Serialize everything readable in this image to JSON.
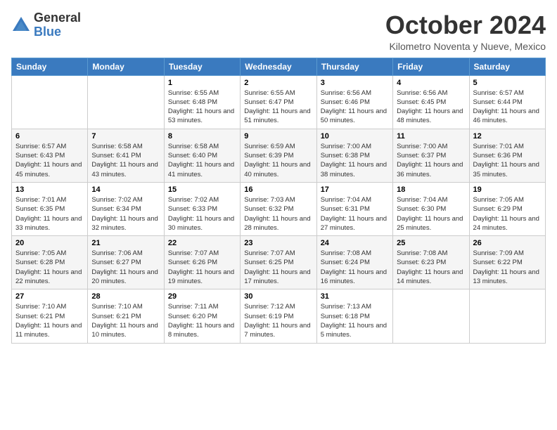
{
  "header": {
    "logo_general": "General",
    "logo_blue": "Blue",
    "month_title": "October 2024",
    "location": "Kilometro Noventa y Nueve, Mexico"
  },
  "days_of_week": [
    "Sunday",
    "Monday",
    "Tuesday",
    "Wednesday",
    "Thursday",
    "Friday",
    "Saturday"
  ],
  "weeks": [
    [
      {
        "day": "",
        "sunrise": "",
        "sunset": "",
        "daylight": ""
      },
      {
        "day": "",
        "sunrise": "",
        "sunset": "",
        "daylight": ""
      },
      {
        "day": "1",
        "sunrise": "Sunrise: 6:55 AM",
        "sunset": "Sunset: 6:48 PM",
        "daylight": "Daylight: 11 hours and 53 minutes."
      },
      {
        "day": "2",
        "sunrise": "Sunrise: 6:55 AM",
        "sunset": "Sunset: 6:47 PM",
        "daylight": "Daylight: 11 hours and 51 minutes."
      },
      {
        "day": "3",
        "sunrise": "Sunrise: 6:56 AM",
        "sunset": "Sunset: 6:46 PM",
        "daylight": "Daylight: 11 hours and 50 minutes."
      },
      {
        "day": "4",
        "sunrise": "Sunrise: 6:56 AM",
        "sunset": "Sunset: 6:45 PM",
        "daylight": "Daylight: 11 hours and 48 minutes."
      },
      {
        "day": "5",
        "sunrise": "Sunrise: 6:57 AM",
        "sunset": "Sunset: 6:44 PM",
        "daylight": "Daylight: 11 hours and 46 minutes."
      }
    ],
    [
      {
        "day": "6",
        "sunrise": "Sunrise: 6:57 AM",
        "sunset": "Sunset: 6:43 PM",
        "daylight": "Daylight: 11 hours and 45 minutes."
      },
      {
        "day": "7",
        "sunrise": "Sunrise: 6:58 AM",
        "sunset": "Sunset: 6:41 PM",
        "daylight": "Daylight: 11 hours and 43 minutes."
      },
      {
        "day": "8",
        "sunrise": "Sunrise: 6:58 AM",
        "sunset": "Sunset: 6:40 PM",
        "daylight": "Daylight: 11 hours and 41 minutes."
      },
      {
        "day": "9",
        "sunrise": "Sunrise: 6:59 AM",
        "sunset": "Sunset: 6:39 PM",
        "daylight": "Daylight: 11 hours and 40 minutes."
      },
      {
        "day": "10",
        "sunrise": "Sunrise: 7:00 AM",
        "sunset": "Sunset: 6:38 PM",
        "daylight": "Daylight: 11 hours and 38 minutes."
      },
      {
        "day": "11",
        "sunrise": "Sunrise: 7:00 AM",
        "sunset": "Sunset: 6:37 PM",
        "daylight": "Daylight: 11 hours and 36 minutes."
      },
      {
        "day": "12",
        "sunrise": "Sunrise: 7:01 AM",
        "sunset": "Sunset: 6:36 PM",
        "daylight": "Daylight: 11 hours and 35 minutes."
      }
    ],
    [
      {
        "day": "13",
        "sunrise": "Sunrise: 7:01 AM",
        "sunset": "Sunset: 6:35 PM",
        "daylight": "Daylight: 11 hours and 33 minutes."
      },
      {
        "day": "14",
        "sunrise": "Sunrise: 7:02 AM",
        "sunset": "Sunset: 6:34 PM",
        "daylight": "Daylight: 11 hours and 32 minutes."
      },
      {
        "day": "15",
        "sunrise": "Sunrise: 7:02 AM",
        "sunset": "Sunset: 6:33 PM",
        "daylight": "Daylight: 11 hours and 30 minutes."
      },
      {
        "day": "16",
        "sunrise": "Sunrise: 7:03 AM",
        "sunset": "Sunset: 6:32 PM",
        "daylight": "Daylight: 11 hours and 28 minutes."
      },
      {
        "day": "17",
        "sunrise": "Sunrise: 7:04 AM",
        "sunset": "Sunset: 6:31 PM",
        "daylight": "Daylight: 11 hours and 27 minutes."
      },
      {
        "day": "18",
        "sunrise": "Sunrise: 7:04 AM",
        "sunset": "Sunset: 6:30 PM",
        "daylight": "Daylight: 11 hours and 25 minutes."
      },
      {
        "day": "19",
        "sunrise": "Sunrise: 7:05 AM",
        "sunset": "Sunset: 6:29 PM",
        "daylight": "Daylight: 11 hours and 24 minutes."
      }
    ],
    [
      {
        "day": "20",
        "sunrise": "Sunrise: 7:05 AM",
        "sunset": "Sunset: 6:28 PM",
        "daylight": "Daylight: 11 hours and 22 minutes."
      },
      {
        "day": "21",
        "sunrise": "Sunrise: 7:06 AM",
        "sunset": "Sunset: 6:27 PM",
        "daylight": "Daylight: 11 hours and 20 minutes."
      },
      {
        "day": "22",
        "sunrise": "Sunrise: 7:07 AM",
        "sunset": "Sunset: 6:26 PM",
        "daylight": "Daylight: 11 hours and 19 minutes."
      },
      {
        "day": "23",
        "sunrise": "Sunrise: 7:07 AM",
        "sunset": "Sunset: 6:25 PM",
        "daylight": "Daylight: 11 hours and 17 minutes."
      },
      {
        "day": "24",
        "sunrise": "Sunrise: 7:08 AM",
        "sunset": "Sunset: 6:24 PM",
        "daylight": "Daylight: 11 hours and 16 minutes."
      },
      {
        "day": "25",
        "sunrise": "Sunrise: 7:08 AM",
        "sunset": "Sunset: 6:23 PM",
        "daylight": "Daylight: 11 hours and 14 minutes."
      },
      {
        "day": "26",
        "sunrise": "Sunrise: 7:09 AM",
        "sunset": "Sunset: 6:22 PM",
        "daylight": "Daylight: 11 hours and 13 minutes."
      }
    ],
    [
      {
        "day": "27",
        "sunrise": "Sunrise: 7:10 AM",
        "sunset": "Sunset: 6:21 PM",
        "daylight": "Daylight: 11 hours and 11 minutes."
      },
      {
        "day": "28",
        "sunrise": "Sunrise: 7:10 AM",
        "sunset": "Sunset: 6:21 PM",
        "daylight": "Daylight: 11 hours and 10 minutes."
      },
      {
        "day": "29",
        "sunrise": "Sunrise: 7:11 AM",
        "sunset": "Sunset: 6:20 PM",
        "daylight": "Daylight: 11 hours and 8 minutes."
      },
      {
        "day": "30",
        "sunrise": "Sunrise: 7:12 AM",
        "sunset": "Sunset: 6:19 PM",
        "daylight": "Daylight: 11 hours and 7 minutes."
      },
      {
        "day": "31",
        "sunrise": "Sunrise: 7:13 AM",
        "sunset": "Sunset: 6:18 PM",
        "daylight": "Daylight: 11 hours and 5 minutes."
      },
      {
        "day": "",
        "sunrise": "",
        "sunset": "",
        "daylight": ""
      },
      {
        "day": "",
        "sunrise": "",
        "sunset": "",
        "daylight": ""
      }
    ]
  ]
}
